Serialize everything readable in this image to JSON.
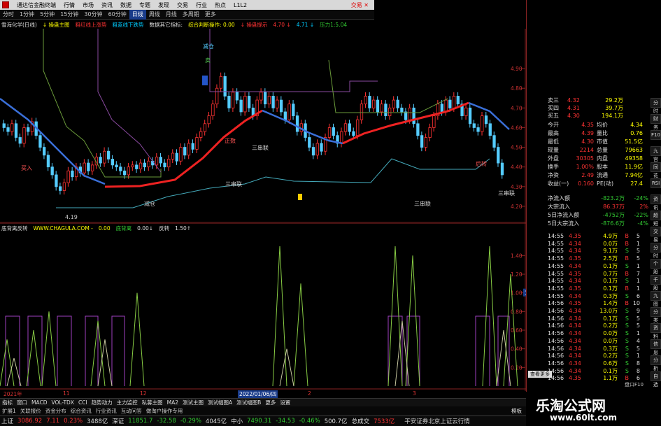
{
  "app": {
    "title": "通达信金融终端",
    "close": "交易 ✕",
    "menu": [
      "行情",
      "市场",
      "资讯",
      "数据",
      "专题",
      "发现",
      "交易",
      "行业",
      "热点",
      "L1L2"
    ]
  },
  "periods": [
    "分时",
    "1分钟",
    "5分钟",
    "15分钟",
    "30分钟",
    "60分钟",
    "日线",
    "周线",
    "月线",
    "多周期",
    "更多"
  ],
  "active_period": "日线",
  "indicator_line": {
    "name": "雪海化学(日线)",
    "items": [
      {
        "t": "↓ 操盘主图",
        "c": "y"
      },
      {
        "t": "粗红线上涨势",
        "c": "r"
      },
      {
        "t": "粗蓝线下跌势",
        "c": "c"
      },
      {
        "t": "数据其它指标:",
        "c": "w"
      },
      {
        "t": "综合判断操作: 0.00",
        "c": "y"
      },
      {
        "t": "↓ 操盘提示",
        "c": "r"
      },
      {
        "t": "4.70 ↓",
        "c": "r"
      },
      {
        "t": "4.71 ↓",
        "c": "c"
      },
      {
        "t": "压力1:5.04",
        "c": "g"
      }
    ]
  },
  "y_axis": [
    "4.90",
    "4.80",
    "4.70",
    "4.60",
    "4.50",
    "4.40",
    "4.30",
    "4.20"
  ],
  "sub_y_axis": [
    "1.40",
    "1.20",
    "1.00",
    "0.80",
    "0.60",
    "0.40",
    "0.20"
  ],
  "annotations": {
    "top": "减仓",
    "top2": "卖",
    "s1": "三串联",
    "s2": "三串联",
    "s3": "三串联",
    "s4": "三串联",
    "low": "4.19",
    "jc": "减仓",
    "cz": "正数",
    "hj": "后转",
    "buy": "买入"
  },
  "sub_info": [
    {
      "t": "底背离反转",
      "c": "w"
    },
    {
      "t": "WWW.CHAGULA.COM -",
      "c": "y"
    },
    {
      "t": "0.00",
      "c": "y"
    },
    {
      "t": "底背离",
      "c": "g"
    },
    {
      "t": "0.00↓",
      "c": "w"
    },
    {
      "t": "反转",
      "c": "w"
    },
    {
      "t": "1.50↑",
      "c": "w"
    }
  ],
  "date_label": "2022/01/06/四",
  "x_labels": [
    "2021年",
    "11",
    "12",
    "2",
    "3"
  ],
  "sub_badge": "1.00",
  "quote": {
    "asks": [
      {
        "l": "卖三",
        "p": "4.32",
        "v": "29.2万"
      },
      {
        "l": "买四",
        "p": "4.31",
        "v": "39.7万"
      },
      {
        "l": "买五",
        "p": "4.30",
        "v": "194.1万"
      }
    ],
    "stats": [
      {
        "a": "今开",
        "av": "4.35",
        "b": "均价",
        "bv": "4.34"
      },
      {
        "a": "最高",
        "av": "4.39",
        "b": "量比",
        "bv": "0.76"
      },
      {
        "a": "最低",
        "av": "4.30",
        "b": "市值",
        "bv": "51.5亿"
      },
      {
        "a": "现量",
        "av": "2214",
        "b": "总量",
        "bv": "79663"
      },
      {
        "a": "外盘",
        "av": "30305",
        "b": "内盘",
        "bv": "49358"
      },
      {
        "a": "换手",
        "av": "1.00%",
        "b": "股本",
        "bv": "11.9亿"
      },
      {
        "a": "净资",
        "av": "2.49",
        "b": "流通",
        "bv": "7.94亿"
      },
      {
        "a": "收益(一)",
        "av": "0.160",
        "b": "PE(动)",
        "bv": "27.4"
      }
    ],
    "flows": [
      {
        "l": "净流入额",
        "v": "-823.2万",
        "p": "-24%"
      },
      {
        "l": "大宗流入",
        "v": "86.37万",
        "p": "2%"
      },
      {
        "l": "5日净流入额",
        "v": "-4752万",
        "p": "-22%"
      },
      {
        "l": "5日大宗流入",
        "v": "-876.6万",
        "p": "-4%"
      }
    ],
    "ticks": [
      [
        "14:55",
        "4.35",
        "4.9万",
        "B",
        "5"
      ],
      [
        "14:55",
        "4.34",
        "0.0万",
        "B",
        "1"
      ],
      [
        "14:55",
        "4.34",
        "9.1万",
        "S",
        "5"
      ],
      [
        "14:55",
        "4.35",
        "2.5万",
        "B",
        "5"
      ],
      [
        "14:55",
        "4.34",
        "0.1万",
        "S",
        "1"
      ],
      [
        "14:55",
        "4.35",
        "0.7万",
        "B",
        "7"
      ],
      [
        "14:55",
        "4.34",
        "0.1万",
        "S",
        "1"
      ],
      [
        "14:55",
        "4.35",
        "0.1万",
        "B",
        "1"
      ],
      [
        "14:55",
        "4.34",
        "0.3万",
        "S",
        "6"
      ],
      [
        "14:56",
        "4.35",
        "1.4万",
        "B",
        "10"
      ],
      [
        "14:56",
        "4.34",
        "13.0万",
        "S",
        "9"
      ],
      [
        "14:56",
        "4.34",
        "0.1万",
        "S",
        "5"
      ],
      [
        "14:56",
        "4.34",
        "0.2万",
        "S",
        "5"
      ],
      [
        "14:56",
        "4.34",
        "0.0万",
        "S",
        "1"
      ],
      [
        "14:56",
        "4.34",
        "0.0万",
        "S",
        "4"
      ],
      [
        "14:56",
        "4.34",
        "0.3万",
        "S",
        "5"
      ],
      [
        "14:56",
        "4.34",
        "0.2万",
        "S",
        "1"
      ],
      [
        "14:56",
        "4.34",
        "0.6万",
        "S",
        "8"
      ],
      [
        "14:56",
        "4.34",
        "0.1万",
        "S",
        "8"
      ],
      [
        "14:56",
        "4.35",
        "1.1万",
        "B",
        "6"
      ]
    ]
  },
  "tabs_row1": [
    "指标",
    "窗口",
    "MACD",
    "VOL-TDX",
    "CCI",
    "趋势动力",
    "主力监控",
    "私募主图",
    "MA2",
    "测试主图",
    "测试幅图A",
    "测试幅图B",
    "更多",
    "设置"
  ],
  "tabs_row2": [
    "扩展1",
    "关联报价",
    "资金分布",
    "综合资讯",
    "行业资讯",
    "互动问答",
    "做淘户操作专用"
  ],
  "right_tab": "模板",
  "status": [
    {
      "l": "上证",
      "v": "3086.92",
      "c": "7.11",
      "p": "0.23%",
      "a": "3488亿"
    },
    {
      "l": "深证",
      "v": "11851.7",
      "c": "-32.58",
      "p": "-0.29%",
      "a": "4045亿"
    },
    {
      "l": "中小",
      "v": "7490.31",
      "c": "-34.53",
      "p": "-0.46%",
      "a": "500.7亿"
    },
    {
      "l": "总成交",
      "v": "7533亿",
      "c": "",
      "p": "",
      "a": ""
    }
  ],
  "status_tail": "平安证券北京上证云行情",
  "watermark": {
    "cn": "乐淘公式网",
    "url": "www.60lt.com"
  },
  "vtabs": [
    "分时",
    "财务",
    "F10",
    "九宫",
    "同花",
    "RSI",
    "资讯",
    "超短",
    "交易",
    "分时",
    "个股",
    "千股",
    "九图",
    "分类",
    "资料",
    "信息",
    "分析",
    "自选"
  ],
  "quote_footer": "查看更多",
  "status_right": "盘口F10"
}
